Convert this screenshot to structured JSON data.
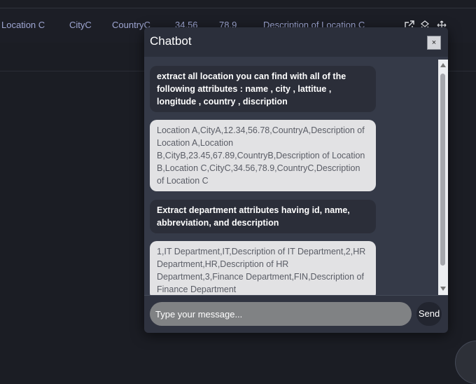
{
  "table_row": {
    "name": "Location C",
    "city": "CityC",
    "country": "CountryC",
    "latitude": "34.56",
    "longitude": "78.9",
    "description": "Description of Location C"
  },
  "chatbot": {
    "title": "Chatbot",
    "close_label": "×",
    "messages": [
      {
        "role": "user",
        "text": "extract all location you can find with all of the following attributes : name , city , lattitue , longitude , country , discription"
      },
      {
        "role": "bot",
        "text": "Location A,CityA,12.34,56.78,CountryA,Description of Location A,Location B,CityB,23.45,67.89,CountryB,Description of Location B,Location C,CityC,34.56,78.9,CountryC,Description of Location C"
      },
      {
        "role": "user",
        "text": "Extract department attributes having id, name, abbreviation, and description"
      },
      {
        "role": "bot",
        "text": "1,IT Department,IT,Description of IT Department,2,HR Department,HR,Description of HR Department,3,Finance Department,FIN,Description of Finance Department"
      }
    ],
    "input": {
      "placeholder": "Type your message...",
      "value": ""
    },
    "send_label": "Send"
  },
  "icons": [
    "external-link-icon",
    "share-icon",
    "move-icon"
  ]
}
